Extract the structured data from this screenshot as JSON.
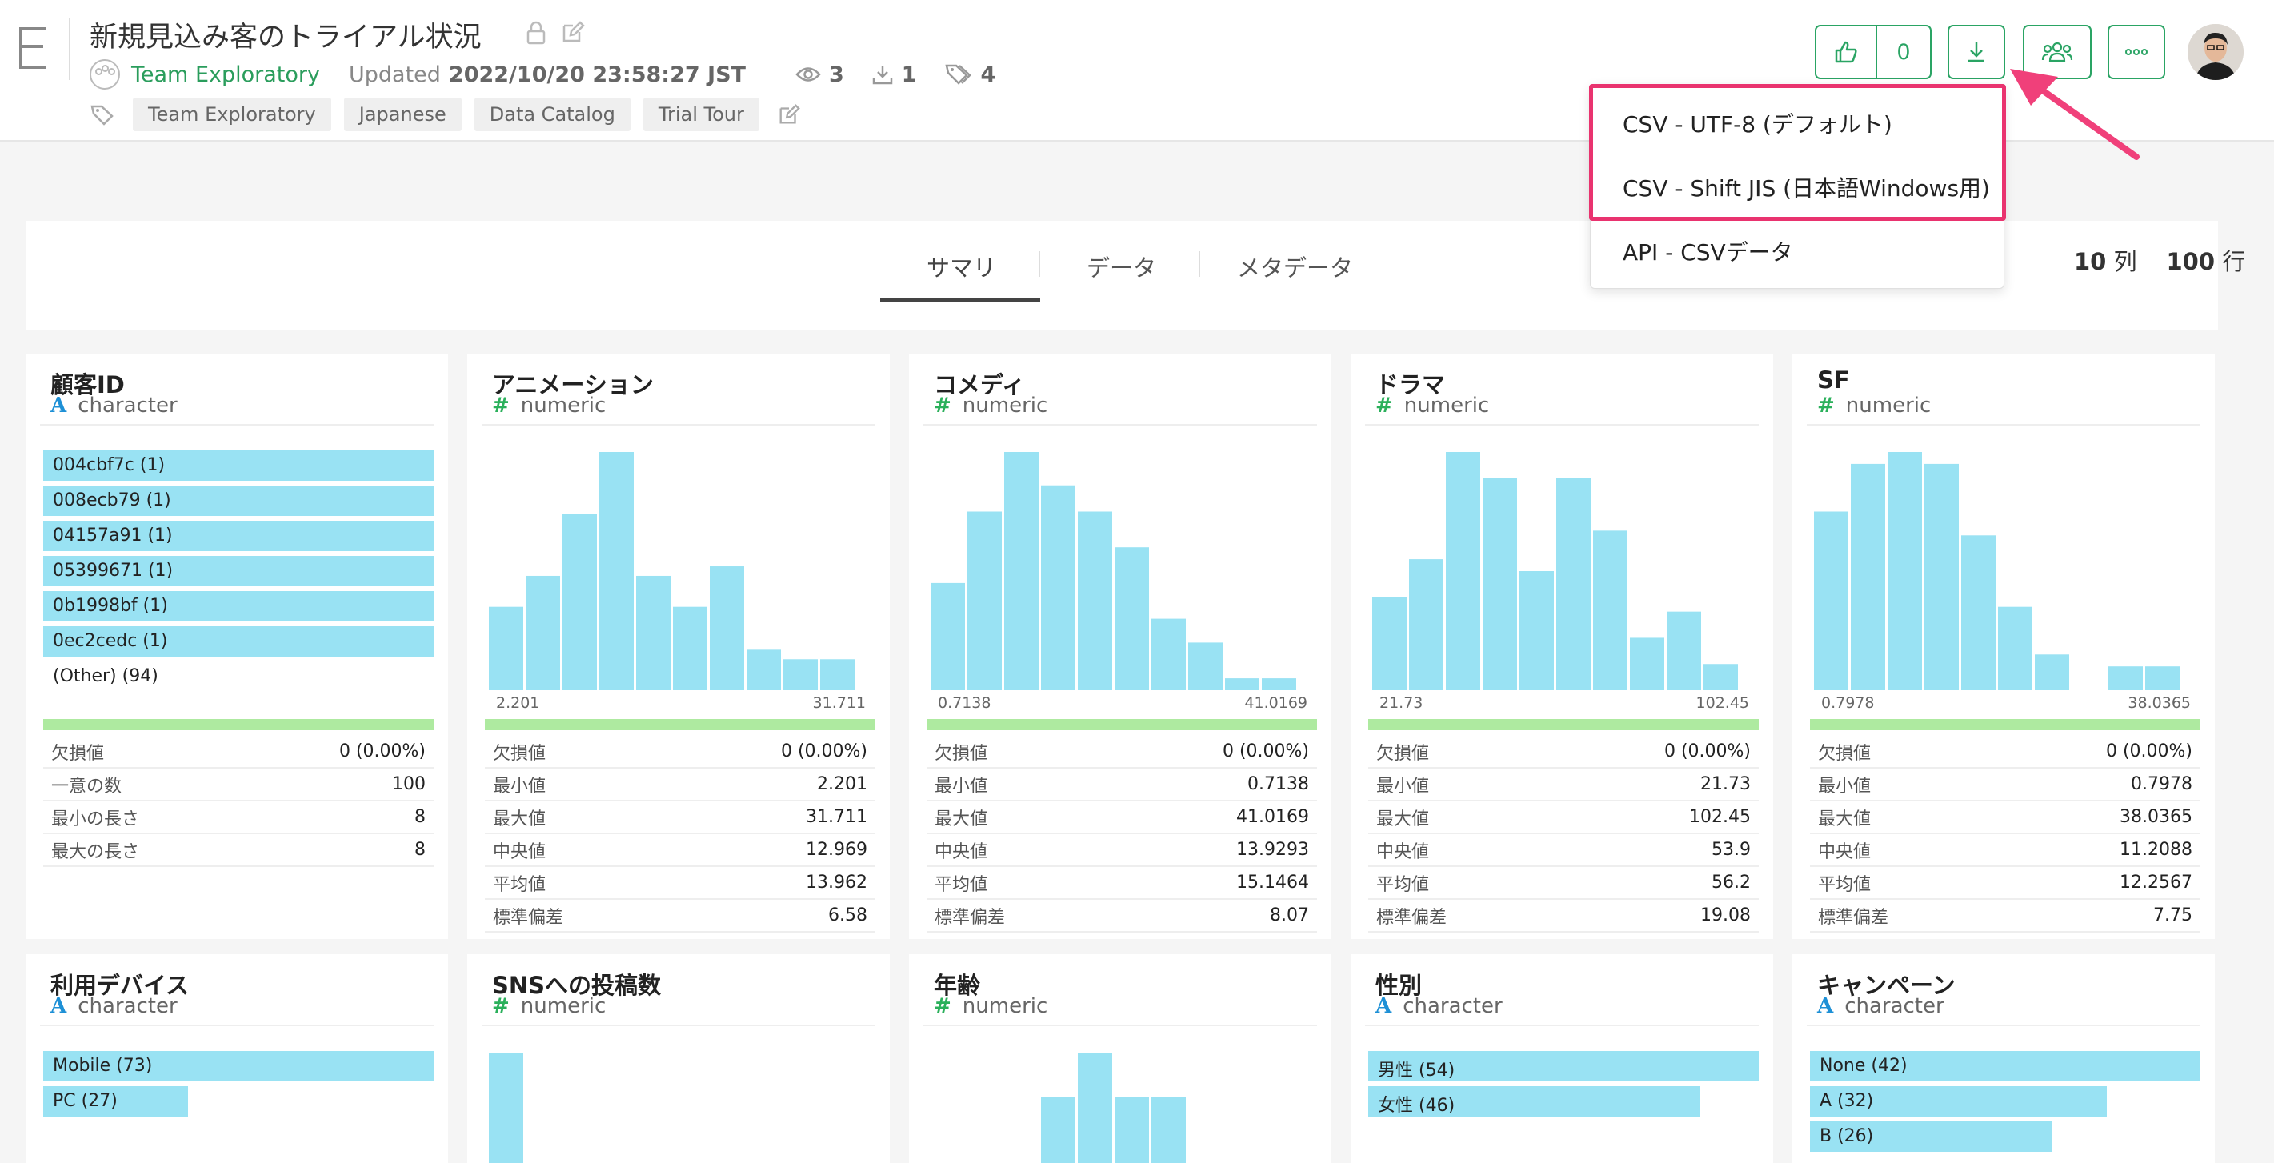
{
  "header": {
    "logo_letter": "E",
    "title": "新規見込み客のトライアル状況",
    "team": "Team Exploratory",
    "updated_label": "Updated",
    "updated_value": "2022/10/20 23:58:27 JST",
    "views": "3",
    "downloads": "1",
    "tag_count": "4",
    "tags": [
      "Team Exploratory",
      "Japanese",
      "Data Catalog",
      "Trial Tour"
    ],
    "like_count": "0",
    "icons": {
      "lock": "lock-icon",
      "edit": "pencil-icon",
      "like": "thumbs-up-icon",
      "download": "download-icon",
      "share": "users-icon",
      "more": "more-icon"
    }
  },
  "download_menu": {
    "items": [
      "CSV - UTF-8 (デフォルト)",
      "CSV - Shift JIS (日本語Windows用)",
      "API - CSVデータ"
    ],
    "highlight_color": "#e9336f"
  },
  "tabs": {
    "items": [
      "サマリ",
      "データ",
      "メタデータ"
    ],
    "active": "サマリ",
    "columns_value": "10",
    "columns_label": "列",
    "rows_value": "100",
    "rows_label": "行"
  },
  "cards": [
    {
      "name": "顧客ID",
      "type": "character",
      "categories": [
        {
          "label": "004cbf7c (1)",
          "fraction": 1
        },
        {
          "label": "008ecb79 (1)",
          "fraction": 1
        },
        {
          "label": "04157a91 (1)",
          "fraction": 1
        },
        {
          "label": "05399671 (1)",
          "fraction": 1
        },
        {
          "label": "0b1998bf (1)",
          "fraction": 1
        },
        {
          "label": "0ec2cedc (1)",
          "fraction": 1
        },
        {
          "label": "(Other) (94)",
          "fraction": 0
        }
      ],
      "stats": [
        [
          "欠損値",
          "0 (0.00%)"
        ],
        [
          "一意の数",
          "100"
        ],
        [
          "最小の長さ",
          "8"
        ],
        [
          "最大の長さ",
          "8"
        ]
      ]
    },
    {
      "name": "アニメーション",
      "type": "numeric",
      "min_label": "2.201",
      "max_label": "31.711",
      "bins": [
        0.35,
        0.48,
        0.74,
        1.0,
        0.48,
        0.35,
        0.52,
        0.17,
        0.13,
        0.13
      ],
      "stats": [
        [
          "欠損値",
          "0 (0.00%)"
        ],
        [
          "最小値",
          "2.201"
        ],
        [
          "最大値",
          "31.711"
        ],
        [
          "中央値",
          "12.969"
        ],
        [
          "平均値",
          "13.962"
        ],
        [
          "標準偏差",
          "6.58"
        ]
      ]
    },
    {
      "name": "コメディ",
      "type": "numeric",
      "min_label": "0.7138",
      "max_label": "41.0169",
      "bins": [
        0.45,
        0.75,
        1.0,
        0.86,
        0.75,
        0.6,
        0.3,
        0.2,
        0.05,
        0.05
      ],
      "stats": [
        [
          "欠損値",
          "0 (0.00%)"
        ],
        [
          "最小値",
          "0.7138"
        ],
        [
          "最大値",
          "41.0169"
        ],
        [
          "中央値",
          "13.9293"
        ],
        [
          "平均値",
          "15.1464"
        ],
        [
          "標準偏差",
          "8.07"
        ]
      ]
    },
    {
      "name": "ドラマ",
      "type": "numeric",
      "min_label": "21.73",
      "max_label": "102.45",
      "bins": [
        0.39,
        0.55,
        1.0,
        0.89,
        0.5,
        0.89,
        0.67,
        0.22,
        0.33,
        0.11
      ],
      "stats": [
        [
          "欠損値",
          "0 (0.00%)"
        ],
        [
          "最小値",
          "21.73"
        ],
        [
          "最大値",
          "102.45"
        ],
        [
          "中央値",
          "53.9"
        ],
        [
          "平均値",
          "56.2"
        ],
        [
          "標準偏差",
          "19.08"
        ]
      ]
    },
    {
      "name": "SF",
      "type": "numeric",
      "min_label": "0.7978",
      "max_label": "38.0365",
      "bins": [
        0.75,
        0.95,
        1.0,
        0.95,
        0.65,
        0.35,
        0.15,
        0.0,
        0.1,
        0.1
      ],
      "stats": [
        [
          "欠損値",
          "0 (0.00%)"
        ],
        [
          "最小値",
          "0.7978"
        ],
        [
          "最大値",
          "38.0365"
        ],
        [
          "中央値",
          "11.2088"
        ],
        [
          "平均値",
          "12.2567"
        ],
        [
          "標準偏差",
          "7.75"
        ]
      ]
    },
    {
      "name": "利用デバイス",
      "type": "character",
      "categories": [
        {
          "label": "Mobile (73)",
          "fraction": 1
        },
        {
          "label": "PC (27)",
          "fraction": 0.37
        }
      ]
    },
    {
      "name": "SNSへの投稿数",
      "type": "numeric",
      "bins": [
        1,
        0,
        0,
        0,
        0,
        0,
        0,
        0,
        0,
        0
      ]
    },
    {
      "name": "年齢",
      "type": "numeric",
      "bins": [
        0.05,
        0,
        0.05,
        0.65,
        1.0,
        0.65,
        0.65,
        0,
        0,
        0
      ]
    },
    {
      "name": "性別",
      "type": "character",
      "categories": [
        {
          "label": "男性 (54)",
          "fraction": 1
        },
        {
          "label": "女性 (46)",
          "fraction": 0.85
        }
      ]
    },
    {
      "name": "キャンペーン",
      "type": "character",
      "categories": [
        {
          "label": "None (42)",
          "fraction": 1
        },
        {
          "label": "A (32)",
          "fraction": 0.76
        },
        {
          "label": "B (26)",
          "fraction": 0.62
        }
      ]
    }
  ],
  "colors": {
    "accent": "#2aa464",
    "bar": "#99e2f3",
    "quality": "#aeeaa0",
    "character_glyph": "#1e90d6",
    "numeric_glyph": "#2bb05b"
  }
}
